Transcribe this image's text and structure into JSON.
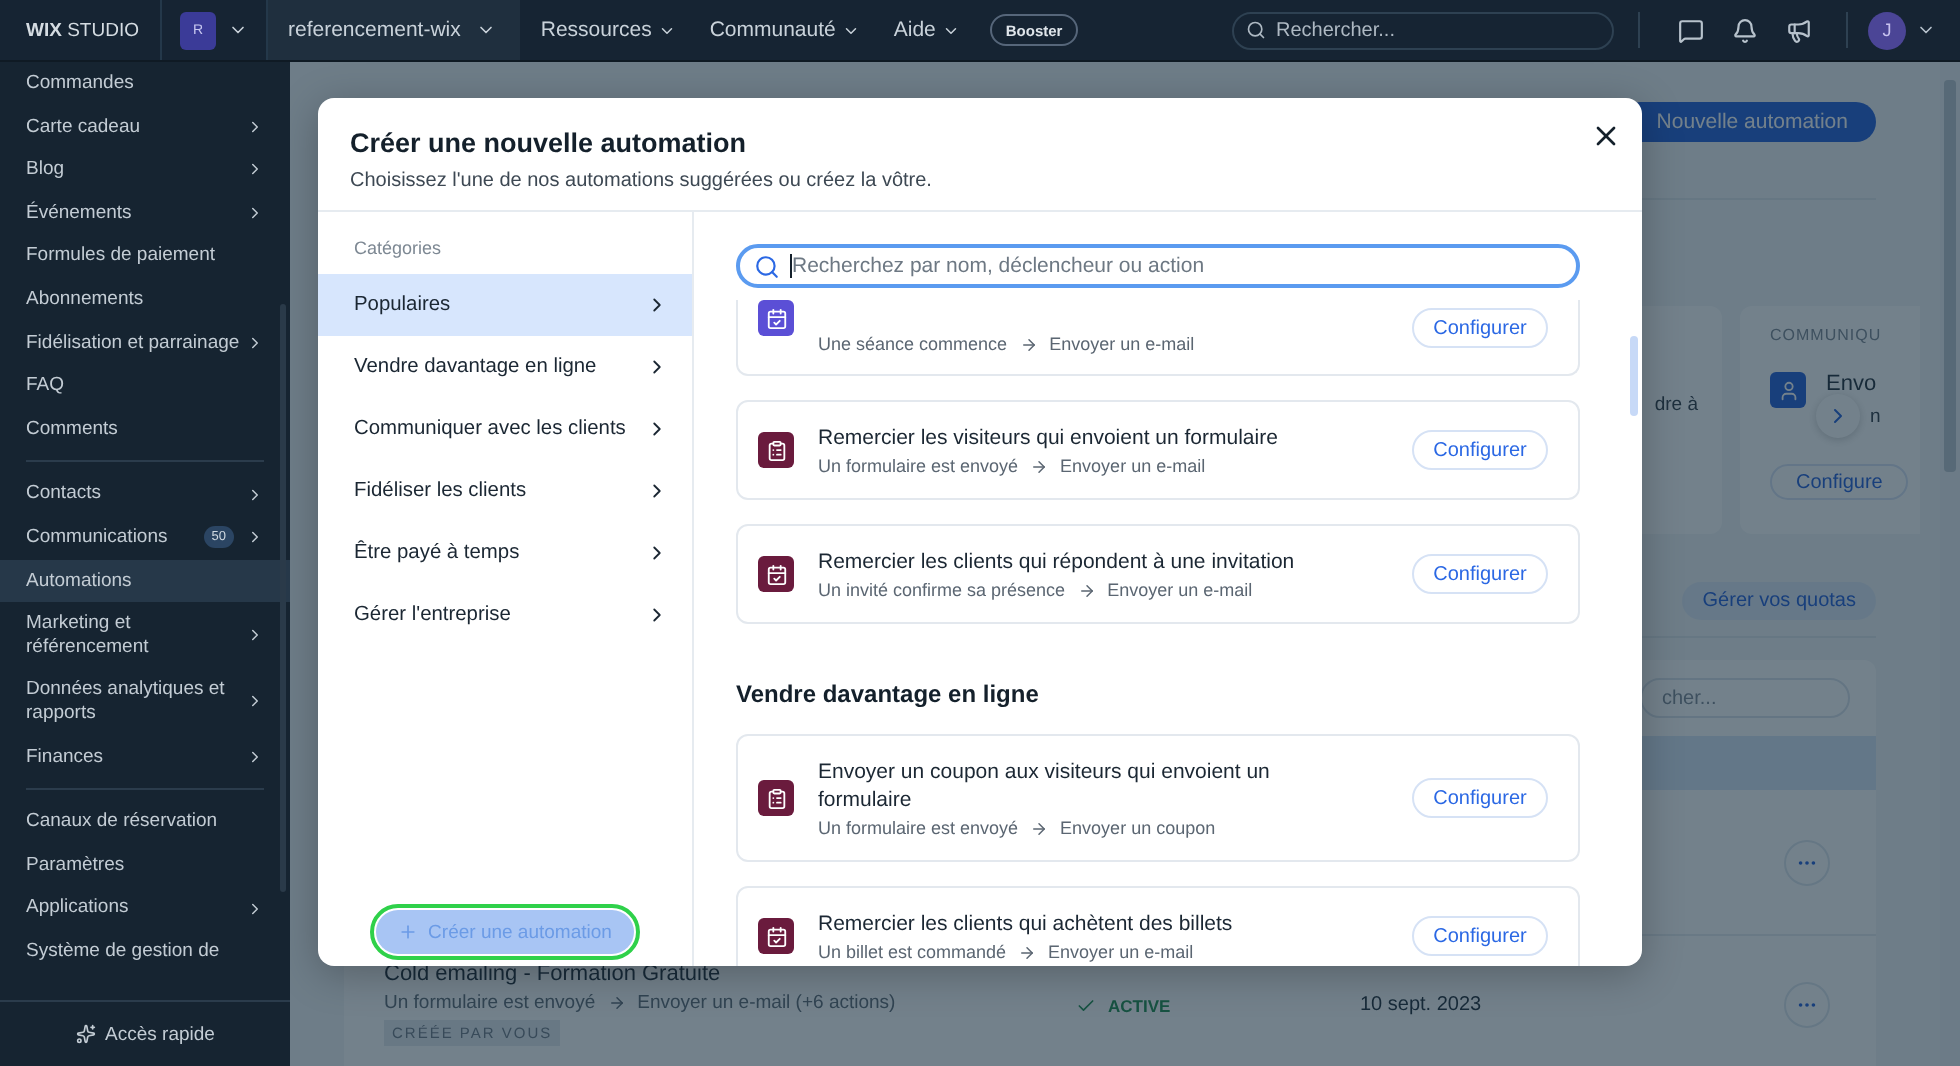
{
  "top_bar": {
    "logo": "**WIX** STUDIO",
    "workspace_initial": "R",
    "site_name": "referencement-wix",
    "nav": [
      "Ressources",
      "Communauté",
      "Aide"
    ],
    "booster": "Booster",
    "search_placeholder": "Rechercher...",
    "user_initial": "J"
  },
  "sidebar": {
    "items": [
      {
        "kind": "link",
        "label": "Commandes",
        "has_submenu": false,
        "selected": false
      },
      {
        "kind": "link",
        "label": "Carte cadeau",
        "has_submenu": true,
        "selected": false
      },
      {
        "kind": "link",
        "label": "Blog",
        "has_submenu": true,
        "selected": false
      },
      {
        "kind": "link",
        "label": "Événements",
        "has_submenu": true,
        "selected": false
      },
      {
        "kind": "link",
        "label": "Formules de paiement",
        "has_submenu": false,
        "selected": false
      },
      {
        "kind": "link",
        "label": "Abonnements",
        "has_submenu": false,
        "selected": false
      },
      {
        "kind": "link",
        "label": "Fidélisation et parrainage",
        "has_submenu": true,
        "selected": false
      },
      {
        "kind": "link",
        "label": "FAQ",
        "has_submenu": false,
        "selected": false
      },
      {
        "kind": "link",
        "label": "Comments",
        "has_submenu": false,
        "selected": false
      },
      {
        "kind": "divider"
      },
      {
        "kind": "link",
        "label": "Contacts",
        "has_submenu": true,
        "selected": false
      },
      {
        "kind": "link",
        "label": "Communications",
        "badge": "50",
        "has_submenu": true,
        "selected": false
      },
      {
        "kind": "link",
        "label": "Automations",
        "has_submenu": false,
        "selected": true
      },
      {
        "kind": "link",
        "label": "Marketing et référencement",
        "has_submenu": true,
        "selected": false
      },
      {
        "kind": "link",
        "label": "Données analytiques et rapports",
        "has_submenu": true,
        "selected": false
      },
      {
        "kind": "link",
        "label": "Finances",
        "has_submenu": true,
        "selected": false
      },
      {
        "kind": "divider"
      },
      {
        "kind": "link",
        "label": "Canaux de réservation",
        "has_submenu": false,
        "selected": false
      },
      {
        "kind": "link",
        "label": "Paramètres",
        "has_submenu": false,
        "selected": false
      },
      {
        "kind": "link",
        "label": "Applications",
        "has_submenu": true,
        "selected": false
      },
      {
        "kind": "link",
        "label": "Système de gestion de",
        "has_submenu": false,
        "selected": false
      }
    ],
    "quick_access": "Accès rapide"
  },
  "page": {
    "new_button": "Nouvelle automation",
    "card_text": "dre à",
    "carousel_card": {
      "category": "COMMUNIQU",
      "title": "Envo",
      "subtitle": "n",
      "button": "Configure"
    },
    "quota_button": "Gérer vos quotas",
    "table_search_placeholder": "cher...",
    "rows": [
      {
        "kind": "covered"
      },
      {
        "kind": "full",
        "name": "Cold emailing - Formation Gratuite",
        "trigger": "Un formulaire est envoyé",
        "action": "Envoyer un e-mail (+6 actions)",
        "tag": "CRÉÉE PAR VOUS",
        "status": "ACTIVE",
        "date": "10 sept. 2023"
      }
    ]
  },
  "modal": {
    "title": "Créer une nouvelle automation",
    "subtitle": "Choisissez l'une de nos automations suggérées ou créez la vôtre.",
    "categories_label": "Catégories",
    "categories": [
      {
        "label": "Populaires",
        "selected": true
      },
      {
        "label": "Vendre davantage en ligne",
        "selected": false
      },
      {
        "label": "Communiquer avec les clients",
        "selected": false
      },
      {
        "label": "Fidéliser les clients",
        "selected": false
      },
      {
        "label": "Être payé à temps",
        "selected": false
      },
      {
        "label": "Gérer l'entreprise",
        "selected": false
      }
    ],
    "create_button": {
      "label": "Créer une automation",
      "focused": true
    },
    "search_placeholder": "Recherchez par nom, déclencheur ou action",
    "list": [
      {
        "kind": "cut",
        "color": "#5b4fd6",
        "trigger": "Une séance commence",
        "action": "Envoyer un e-mail",
        "button": "Configurer"
      },
      {
        "kind": "form",
        "color": "#6a1b3d",
        "title": "Remercier les visiteurs qui envoient un formulaire",
        "trigger": "Un formulaire est envoyé",
        "action": "Envoyer un e-mail",
        "button": "Configurer"
      },
      {
        "kind": "calendar",
        "color": "#6a1b3d",
        "title": "Remercier les clients qui répondent à une invitation",
        "trigger": "Un invité confirme sa présence",
        "action": "Envoyer un e-mail",
        "button": "Configurer"
      },
      {
        "kind": "heading",
        "text": "Vendre davantage en ligne"
      },
      {
        "kind": "form",
        "color": "#6a1b3d",
        "title": "Envoyer un coupon aux visiteurs qui envoient un formulaire",
        "trigger": "Un formulaire est envoyé",
        "action": "Envoyer un coupon",
        "button": "Configurer"
      },
      {
        "kind": "calendar",
        "color": "#6a1b3d",
        "title": "Remercier les clients qui achètent des billets",
        "trigger": "Un billet est commandé",
        "action": "Envoyer un e-mail",
        "button": "Configurer"
      }
    ]
  }
}
